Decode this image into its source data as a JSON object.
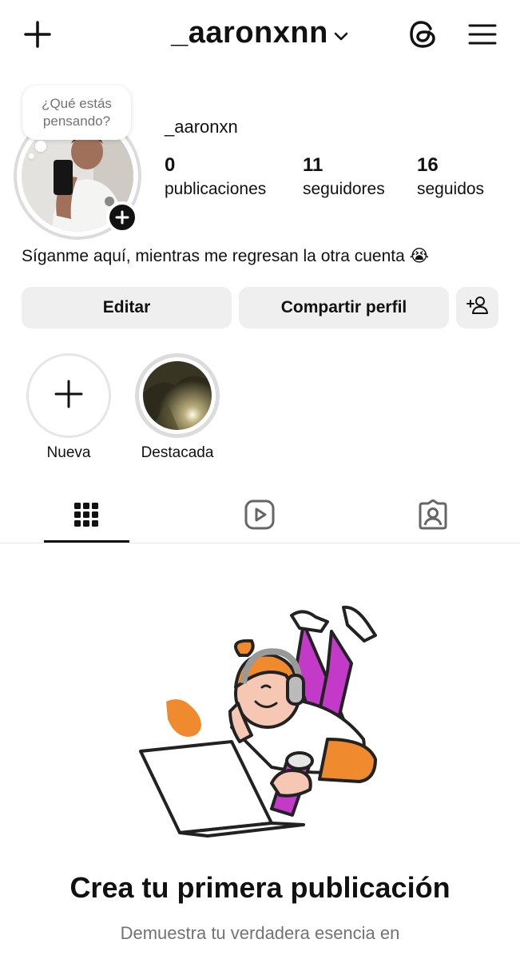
{
  "header": {
    "username": "_aaronxnn",
    "create_icon": "plus-icon",
    "dropdown_icon": "chevron-down-icon",
    "threads_icon": "threads-icon",
    "menu_icon": "hamburger-menu-icon"
  },
  "profile": {
    "note_text": "¿Qué estás pensando?",
    "display_name": "_aaronxn",
    "stats": [
      {
        "value": "0",
        "label": "publicaciones"
      },
      {
        "value": "11",
        "label": "seguidores"
      },
      {
        "value": "16",
        "label": "seguidos"
      }
    ],
    "bio": "Síganme aquí, mientras me regresan la otra cuenta 😭"
  },
  "actions": {
    "edit_label": "Editar",
    "share_label": "Compartir perfil",
    "add_person_icon": "add-person-icon"
  },
  "highlights": [
    {
      "label": "Nueva"
    },
    {
      "label": "Destacada"
    }
  ],
  "tabs": {
    "active": "grid",
    "items": [
      "grid-icon",
      "reels-icon",
      "tagged-icon"
    ]
  },
  "empty_state": {
    "title": "Crea tu primera publicación",
    "subtitle": "Demuestra tu verdadera esencia en"
  },
  "colors": {
    "button_bg": "#efefef",
    "secondary_text": "#737373",
    "illustration_orange": "#f08a2e",
    "illustration_purple": "#c23ac7"
  }
}
